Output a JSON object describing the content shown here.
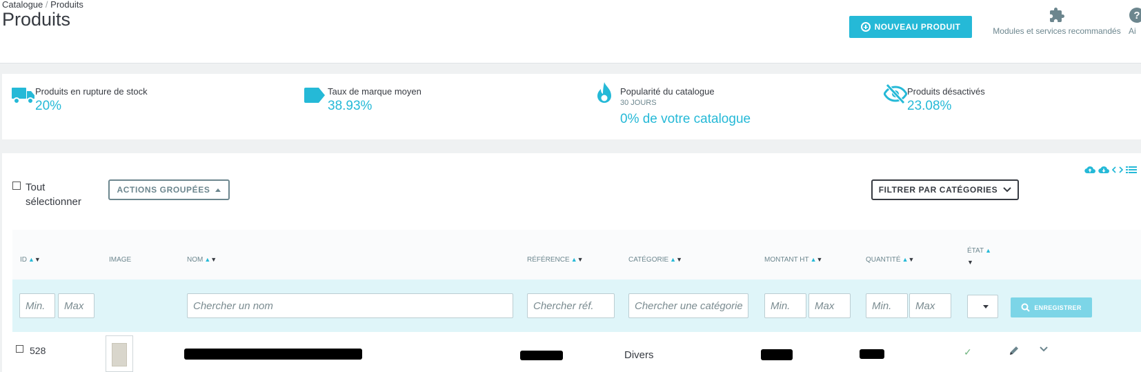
{
  "breadcrumb": {
    "parent": "Catalogue",
    "separator": "/",
    "current": "Produits"
  },
  "page_title": "Produits",
  "header": {
    "new_product_label": "NOUVEAU PRODUIT",
    "modules_label": "Modules et services recommandés",
    "help_label": "Ai"
  },
  "kpis": [
    {
      "label": "Produits en rupture de stock",
      "value": "20%",
      "icon": "truck-icon"
    },
    {
      "label": "Taux de marque moyen",
      "value": "38.93%",
      "icon": "tag-icon"
    },
    {
      "label": "Popularité du catalogue",
      "sub": "30 JOURS",
      "value": "0% de votre catalogue",
      "icon": "flame-icon"
    },
    {
      "label": "Produits désactivés",
      "value": "23.08%",
      "icon": "eye-slash-icon"
    }
  ],
  "toolbar": {
    "select_all_label": "Tout sélectionner",
    "bulk_actions_label": "ACTIONS GROUPÉES",
    "filter_categories_label": "FILTRER PAR CATÉGORIES"
  },
  "columns": {
    "id": "ID",
    "image": "IMAGE",
    "name": "NOM",
    "reference": "RÉFÉRENCE",
    "category": "CATÉGORIE",
    "price": "MONTANT HT",
    "quantity": "QUANTITÉ",
    "state": "ÉTAT"
  },
  "filters": {
    "id_min": "Min.",
    "id_max": "Max",
    "name": "Chercher un nom",
    "reference": "Chercher réf.",
    "category": "Chercher une catégorie",
    "price_min": "Min.",
    "price_max": "Max",
    "qty_min": "Min.",
    "qty_max": "Max",
    "save_label": "ENREGISTRER"
  },
  "rows": [
    {
      "id": "528",
      "category": "Divers"
    }
  ],
  "colors": {
    "accent": "#25b9d7",
    "text": "#363a41",
    "muted": "#6c868e",
    "success": "#70b580"
  }
}
